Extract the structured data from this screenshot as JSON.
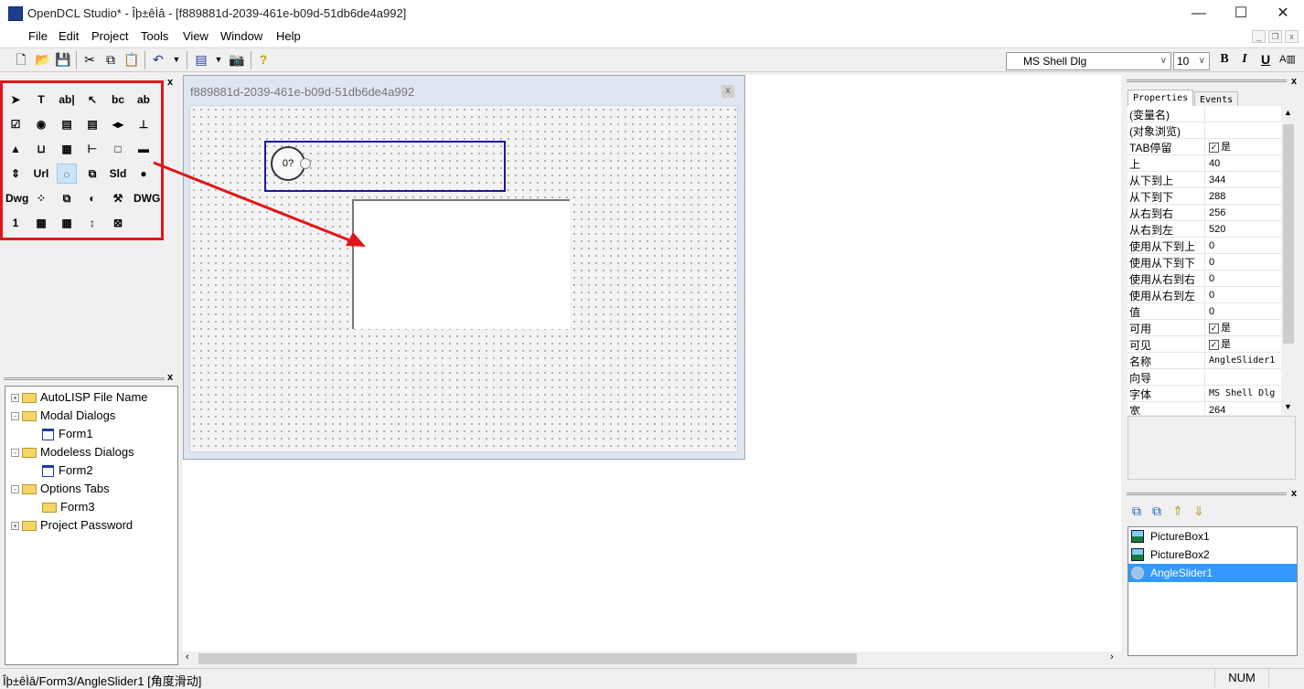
{
  "window": {
    "title": "OpenDCL Studio* - Îþ±êÌâ - [f889881d-2039-461e-b09d-51db6de4a992]",
    "minimize": "—",
    "maximize": "☐",
    "close": "✕"
  },
  "menu": [
    "File",
    "Edit",
    "Project",
    "Tools",
    "View",
    "Window",
    "Help"
  ],
  "toolbar": {
    "font_name": "MS Shell Dlg",
    "font_size": "10",
    "bold": "B",
    "italic": "I",
    "underline": "U"
  },
  "toolbox": {
    "title_close": "x",
    "tools": [
      "➤",
      "T",
      "ab|",
      "↖",
      "bc",
      "ab",
      "☑",
      "◉",
      "▤",
      "▤",
      "◂▸",
      "⊥",
      "▲",
      "⊔",
      "▦",
      "⊢",
      "□",
      "▬",
      "⇕",
      "Url",
      "◌",
      "⧉",
      "Sld",
      "●",
      "Dwg",
      "⁘",
      "⧉",
      "◐",
      "⚒",
      "DWG",
      "1",
      "▦",
      "▦",
      "↕",
      "⊠"
    ]
  },
  "tree": {
    "close": "x",
    "items": [
      {
        "label": "AutoLISP File Name",
        "level": 0,
        "type": "folder",
        "expander": "+"
      },
      {
        "label": "Modal Dialogs",
        "level": 0,
        "type": "folder",
        "expander": "-"
      },
      {
        "label": "Form1",
        "level": 1,
        "type": "form"
      },
      {
        "label": "Modeless Dialogs",
        "level": 0,
        "type": "folder",
        "expander": "-"
      },
      {
        "label": "Form2",
        "level": 1,
        "type": "form"
      },
      {
        "label": "Options Tabs",
        "level": 0,
        "type": "folder",
        "expander": "-"
      },
      {
        "label": "Form3",
        "level": 1,
        "type": "folder"
      },
      {
        "label": "Project Password",
        "level": 0,
        "type": "folder",
        "expander": "+"
      }
    ]
  },
  "form_window": {
    "title": "f889881d-2039-461e-b09d-51db6de4a992",
    "close": "x",
    "angle_slider_text": "0?"
  },
  "properties": {
    "close": "x",
    "tabs": [
      "Properties",
      "Events"
    ],
    "active_tab": "Properties",
    "rows": [
      {
        "name": "(变量名)",
        "value": ""
      },
      {
        "name": "(对象浏览)",
        "value": ""
      },
      {
        "name": "TAB停留",
        "value": "是",
        "checked": true
      },
      {
        "name": "上",
        "value": "40"
      },
      {
        "name": "从下到上",
        "value": "344"
      },
      {
        "name": "从下到下",
        "value": "288"
      },
      {
        "name": "从右到右",
        "value": "256"
      },
      {
        "name": "从右到左",
        "value": "520"
      },
      {
        "name": "使用从下到上",
        "value": "0"
      },
      {
        "name": "使用从下到下",
        "value": "0"
      },
      {
        "name": "使用从右到右",
        "value": "0"
      },
      {
        "name": "使用从右到左",
        "value": "0"
      },
      {
        "name": "值",
        "value": "0"
      },
      {
        "name": "可用",
        "value": "是",
        "checked": true
      },
      {
        "name": "可见",
        "value": "是",
        "checked": true
      },
      {
        "name": "名称",
        "value": "AngleSlider1"
      },
      {
        "name": "向导",
        "value": ""
      },
      {
        "name": "字体",
        "value": "MS Shell Dlg"
      },
      {
        "name": "宽",
        "value": "264"
      }
    ]
  },
  "objects": {
    "close": "x",
    "items": [
      "PictureBox1",
      "PictureBox2",
      "AngleSlider1"
    ],
    "selected": "AngleSlider1",
    "selection_color": "#3399ff"
  },
  "statusbar": {
    "path": "Îþ±êÌâ/Form3/AngleSlider1 [角度滑动]",
    "num": "NUM"
  }
}
